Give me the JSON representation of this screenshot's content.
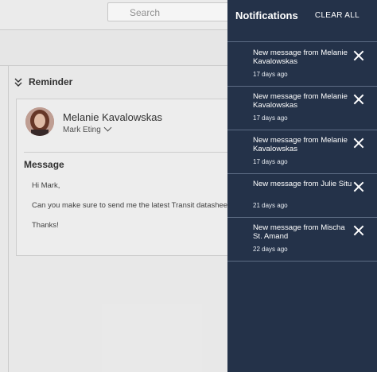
{
  "search": {
    "placeholder": "Search"
  },
  "reminder": {
    "title": "Reminder",
    "sender_name": "Melanie Kavalowskas",
    "recipient_name": "Mark Eting",
    "message_heading": "Message",
    "message_lines": [
      "Hi Mark,",
      "Can you make sure to send me the latest Transit datasheet t",
      "Thanks!"
    ]
  },
  "notifications": {
    "title": "Notifications",
    "clear_all_label": "CLEAR ALL",
    "items": [
      {
        "text": "New message from Melanie Kavalowskas",
        "time": "17 days ago"
      },
      {
        "text": "New message from Melanie Kavalowskas",
        "time": "17 days ago"
      },
      {
        "text": "New message from Melanie Kavalowskas",
        "time": "17 days ago"
      },
      {
        "text": "New message from Julie Situ",
        "time": "21 days ago"
      },
      {
        "text": "New message from Mischa St. Amand",
        "time": "22 days ago"
      }
    ]
  },
  "colors": {
    "panel_bg": "#243249",
    "page_bg": "#f2f2f2",
    "divider": "#5d6c84"
  },
  "icons": [
    "search-icon",
    "double-chevron-down-icon",
    "chevron-down-icon",
    "close-icon",
    "avatar"
  ]
}
